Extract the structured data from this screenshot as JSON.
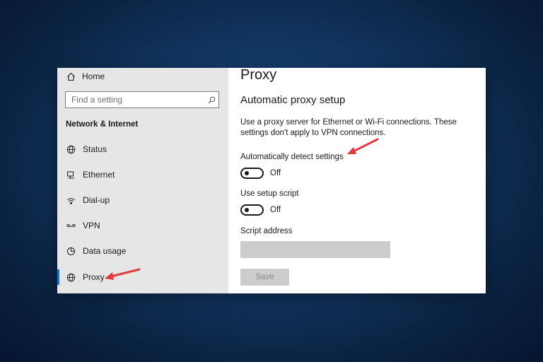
{
  "sidebar": {
    "home_label": "Home",
    "search_placeholder": "Find a setting",
    "section_title": "Network & Internet",
    "items": [
      {
        "label": "Status",
        "icon": "globe-status-icon"
      },
      {
        "label": "Ethernet",
        "icon": "ethernet-icon"
      },
      {
        "label": "Dial-up",
        "icon": "dial-up-icon"
      },
      {
        "label": "VPN",
        "icon": "vpn-icon"
      },
      {
        "label": "Data usage",
        "icon": "data-usage-icon"
      },
      {
        "label": "Proxy",
        "icon": "globe-icon",
        "active": true
      }
    ]
  },
  "content": {
    "title": "Proxy",
    "subtitle": "Automatic proxy setup",
    "description": "Use a proxy server for Ethernet or Wi-Fi connections. These settings don't apply to VPN connections.",
    "auto_detect": {
      "label": "Automatically detect settings",
      "state": "Off"
    },
    "setup_script": {
      "label": "Use setup script",
      "state": "Off"
    },
    "script_address": {
      "label": "Script address",
      "value": ""
    },
    "save_label": "Save"
  },
  "colors": {
    "accent": "#0078d7",
    "arrow": "#e03a3a",
    "sidebar_bg": "#e6e6e6"
  }
}
